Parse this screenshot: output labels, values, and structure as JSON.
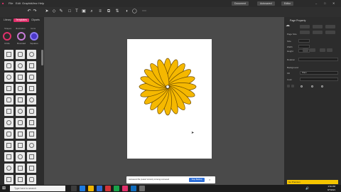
{
  "menubar": {
    "items": [
      "File",
      "Edit",
      "Graphic",
      "View",
      "Help"
    ],
    "right_items": [
      "Document",
      "Autosaved",
      "Editor"
    ]
  },
  "toolbar": {
    "icons": [
      "undo-icon",
      "redo-icon",
      "select-icon",
      "node-icon",
      "text-icon",
      "pen-icon",
      "shape-icon",
      "zoom-icon"
    ]
  },
  "left_panel": {
    "tabs": [
      "Library",
      "Templates",
      "Cliparts"
    ],
    "active_tab": "Templates",
    "subtabs": [
      "Shapes",
      "Illustration",
      "Icons"
    ],
    "circle_labels": [
      "Circle",
      "Rounded",
      "Squares"
    ]
  },
  "canvas": {
    "flower_petals": 20,
    "petal_color": "#f5b800",
    "petal_stroke": "#6b4a00"
  },
  "notice": {
    "text": "Autosaved file (Latest Version) is being recovered",
    "button": "Stop Backup",
    "close": "×"
  },
  "right_panel": {
    "title": "Page Property",
    "labels": [
      "Page Size",
      "Size",
      "Width",
      "Height",
      "Rotation",
      "Background",
      "Fill",
      "Color"
    ],
    "fill_value": "Plain"
  },
  "ad": {
    "text": "Go Premium"
  },
  "taskbar": {
    "search_placeholder": "Type here to search",
    "time": "2:52 PM",
    "date": "8/7/2021"
  },
  "colors": {
    "accent": "#e0306b",
    "background": "#3a3a3a",
    "page": "#ffffff"
  }
}
